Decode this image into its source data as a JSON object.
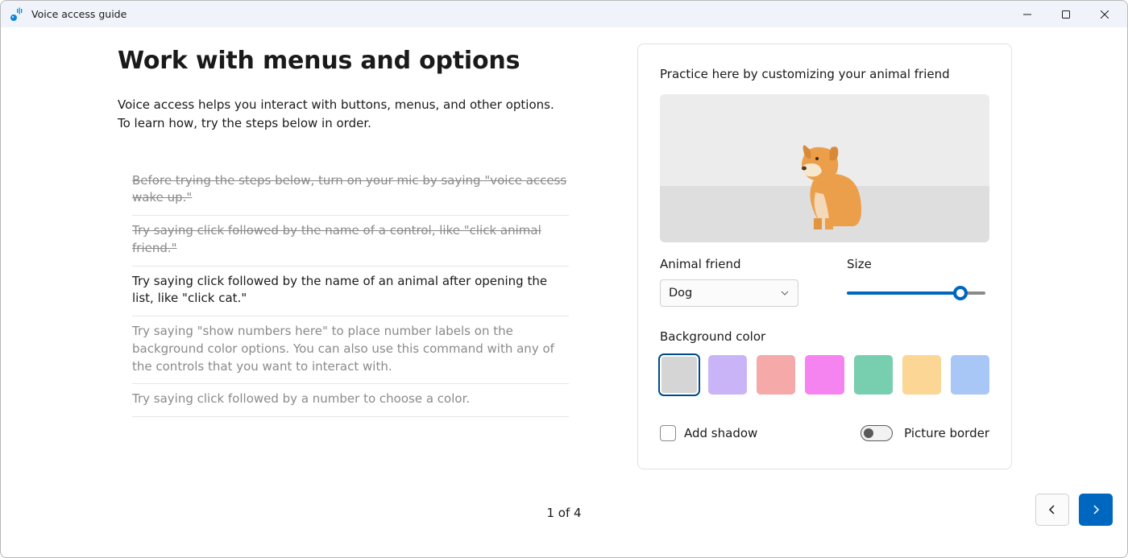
{
  "window": {
    "title": "Voice access guide"
  },
  "main": {
    "title": "Work with menus and options",
    "description": "Voice access helps you interact with buttons, menus, and other options. To learn how, try the steps below in order.",
    "steps": [
      {
        "text": "Before trying the steps below, turn on your mic by saying \"voice access wake up.\"",
        "state": "done"
      },
      {
        "text": "Try saying click followed by the name of a control, like \"click animal friend.\"",
        "state": "done"
      },
      {
        "text": "Try saying click followed by the name of an animal after opening the list, like \"click cat.\"",
        "state": "current"
      },
      {
        "text": "Try saying \"show numbers here\" to place number labels on the background color options. You can also use this command with any of the controls that you want to interact with.",
        "state": "pending"
      },
      {
        "text": "Try saying click followed by a number to choose a color.",
        "state": "pending"
      }
    ]
  },
  "practice": {
    "heading": "Practice here by customizing your animal friend",
    "animal_label": "Animal friend",
    "animal_value": "Dog",
    "size_label": "Size",
    "size_value": 80,
    "bg_label": "Background color",
    "colors": [
      {
        "name": "light-gray",
        "hex": "#d5d5d5",
        "selected": true
      },
      {
        "name": "lavender",
        "hex": "#c9b4f8",
        "selected": false
      },
      {
        "name": "salmon",
        "hex": "#f5a9a9",
        "selected": false
      },
      {
        "name": "pink",
        "hex": "#f584f0",
        "selected": false
      },
      {
        "name": "mint",
        "hex": "#77cfaf",
        "selected": false
      },
      {
        "name": "peach",
        "hex": "#fbd694",
        "selected": false
      },
      {
        "name": "sky",
        "hex": "#a8c6f6",
        "selected": false
      }
    ],
    "shadow_label": "Add shadow",
    "shadow_checked": false,
    "border_label": "Picture border",
    "border_on": false
  },
  "footer": {
    "page_counter": "1 of 4"
  }
}
